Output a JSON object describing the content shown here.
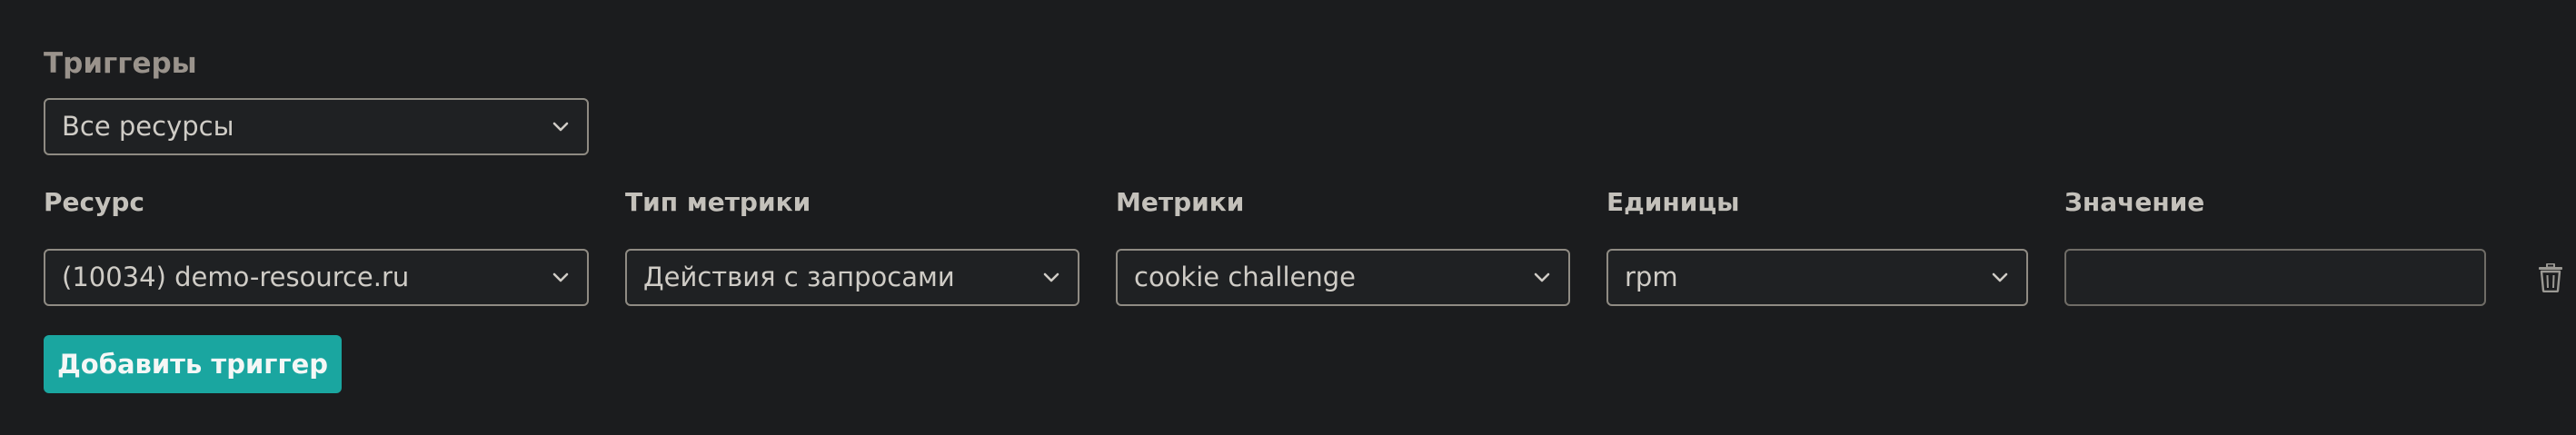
{
  "triggers": {
    "title": "Триггеры",
    "filter_value": "Все ресурсы"
  },
  "columns": {
    "resource": "Ресурс",
    "metric_type": "Тип метрики",
    "metrics": "Метрики",
    "units": "Единицы",
    "value": "Значение"
  },
  "row": {
    "resource": "(10034) demo-resource.ru",
    "metric_type": "Действия с запросами",
    "metrics": "cookie challenge",
    "units": "rpm",
    "value": ""
  },
  "actions": {
    "add_trigger": "Добавить триггер"
  },
  "icons": {
    "select_arrow": "chevron-down-icon",
    "delete": "trash-icon"
  },
  "colors": {
    "background": "#1b1c1e",
    "accent": "#1aa6a0",
    "title": "#9a938c",
    "label": "#c4c1bb",
    "border": "#8f8b83"
  }
}
